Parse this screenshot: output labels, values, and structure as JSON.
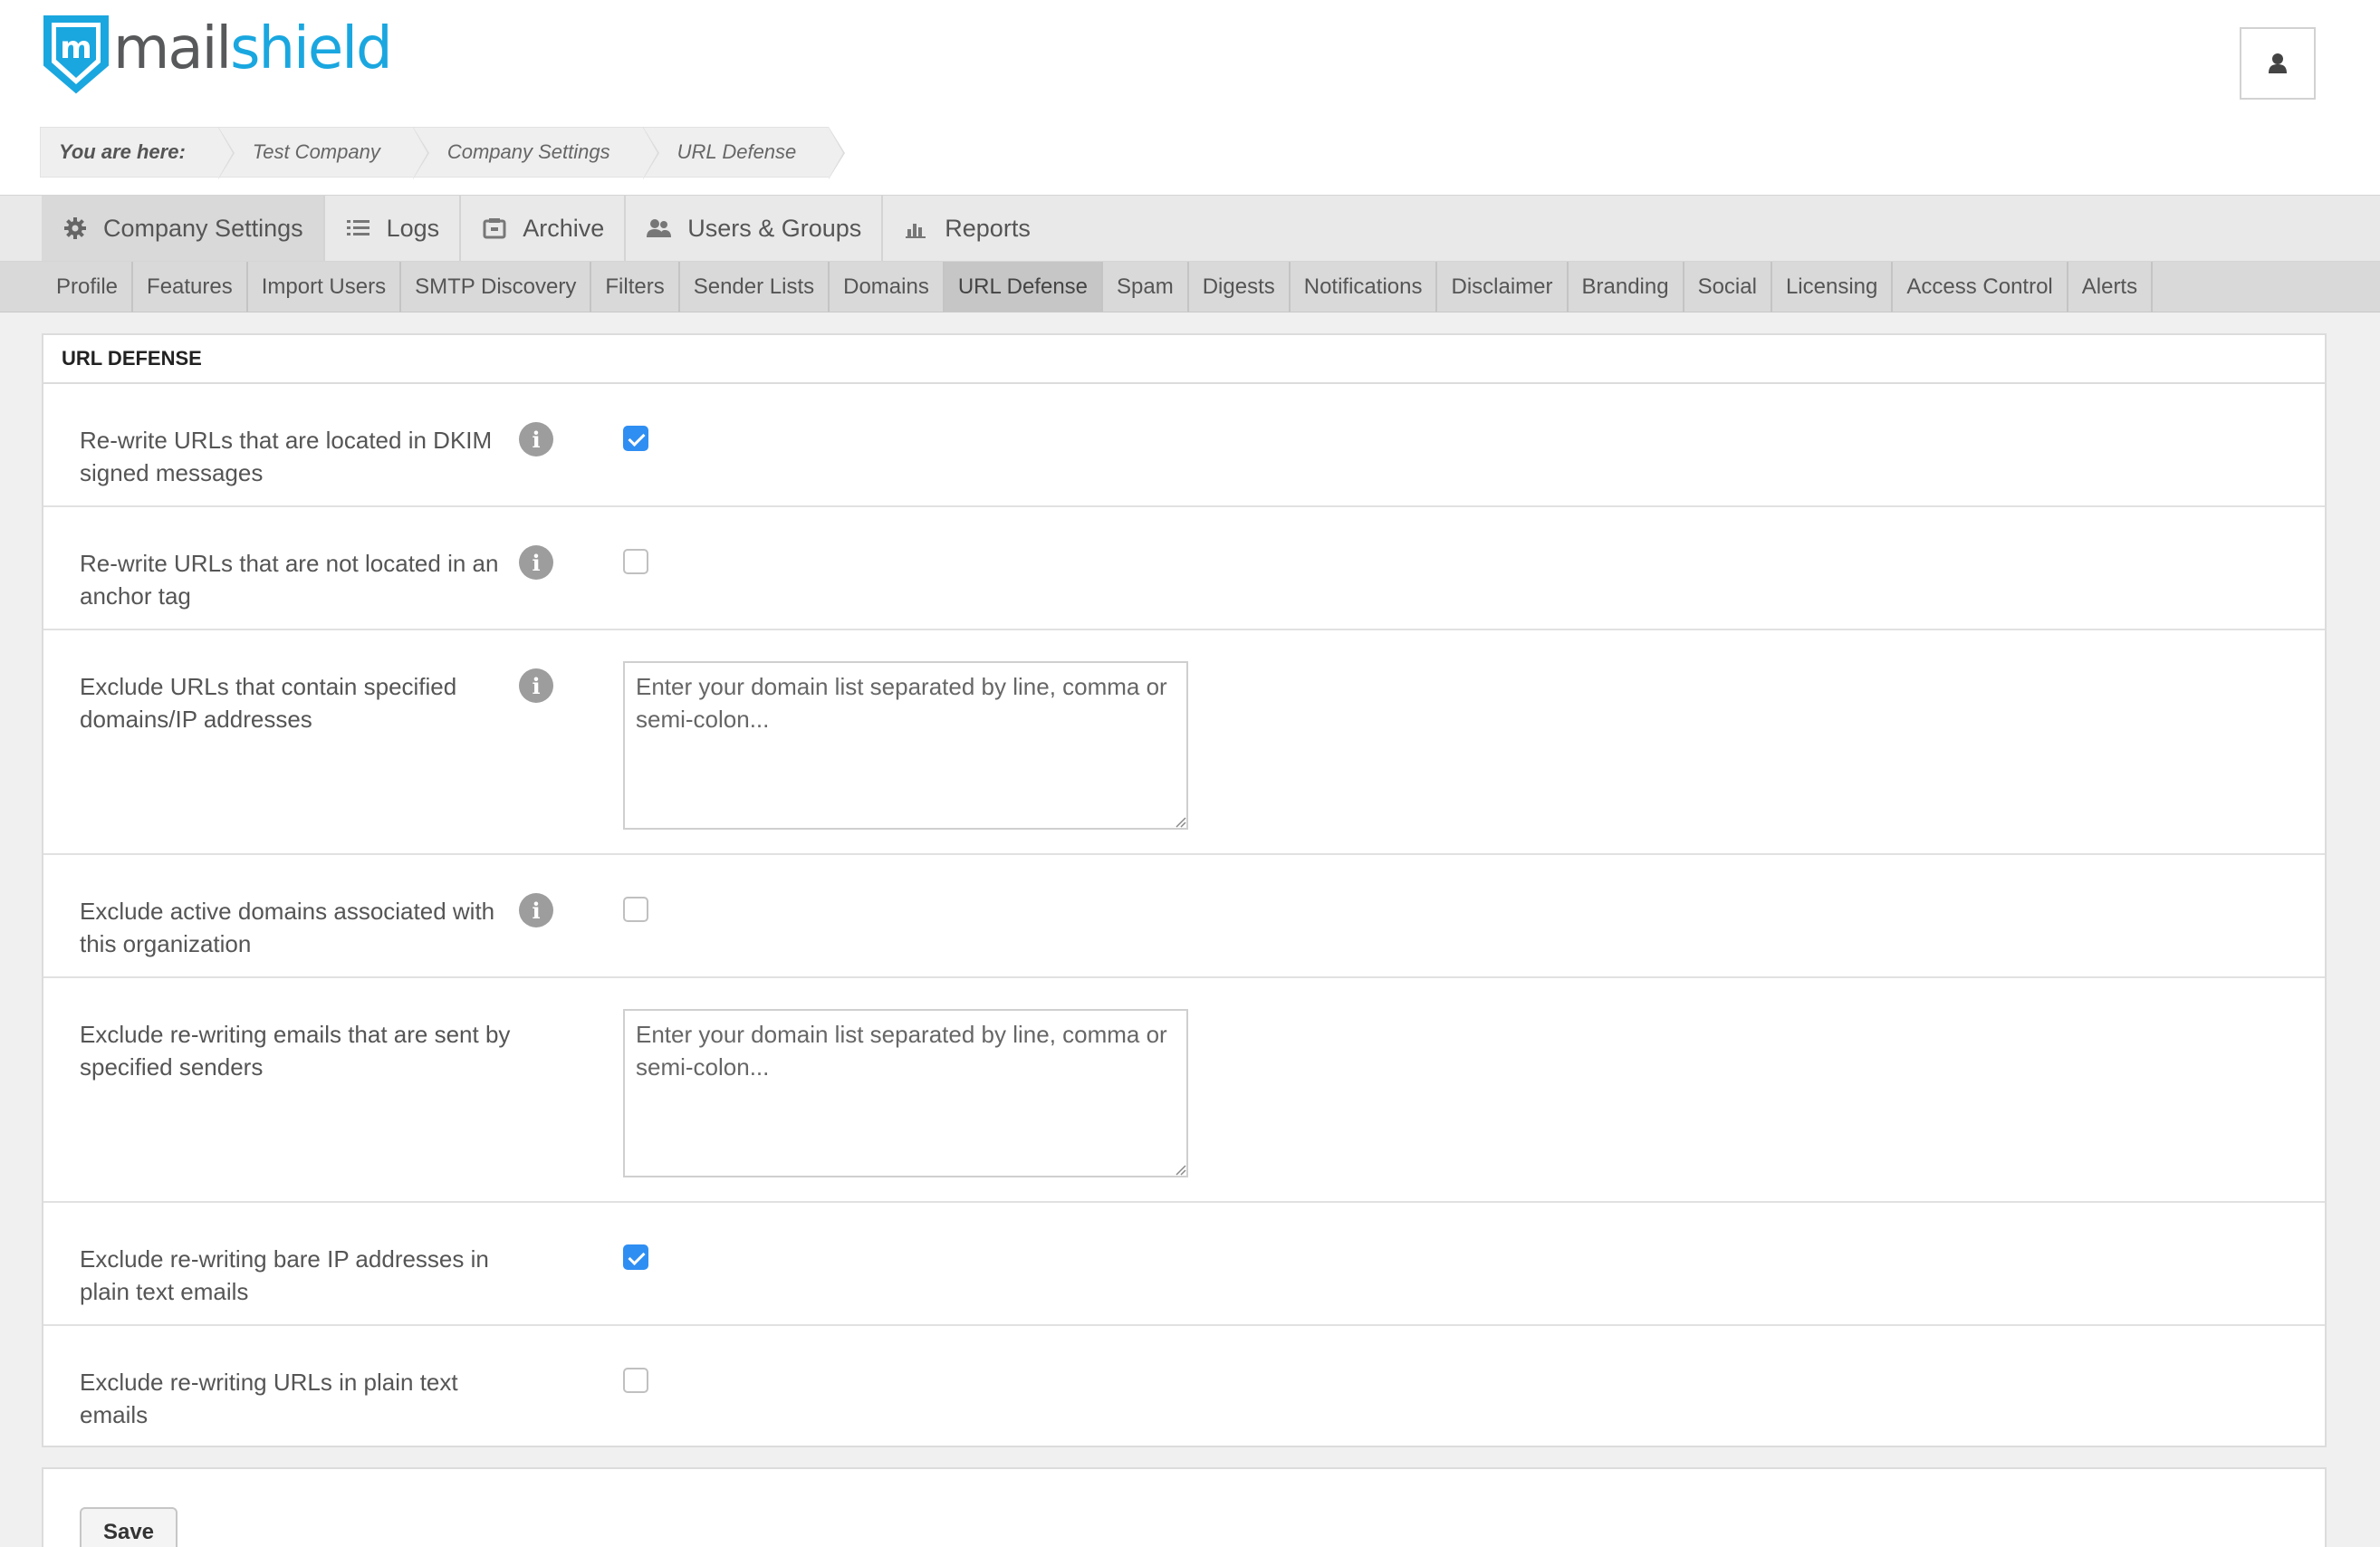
{
  "brand": {
    "mail": "mail",
    "shield": "shield",
    "logo_letter": "m",
    "accent": "#1aa7e0"
  },
  "header": {
    "user_icon": "user-icon"
  },
  "breadcrumb": {
    "prefix": "You are here:",
    "items": [
      "Test Company",
      "Company Settings",
      "URL Defense"
    ]
  },
  "main_nav": {
    "tabs": [
      {
        "label": "Company Settings",
        "icon": "gear-icon",
        "active": true
      },
      {
        "label": "Logs",
        "icon": "list-icon"
      },
      {
        "label": "Archive",
        "icon": "archive-icon"
      },
      {
        "label": "Users & Groups",
        "icon": "users-icon"
      },
      {
        "label": "Reports",
        "icon": "bar-chart-icon"
      }
    ]
  },
  "sub_nav": {
    "tabs": [
      "Profile",
      "Features",
      "Import Users",
      "SMTP Discovery",
      "Filters",
      "Sender Lists",
      "Domains",
      "URL Defense",
      "Spam",
      "Digests",
      "Notifications",
      "Disclaimer",
      "Branding",
      "Social",
      "Licensing",
      "Access Control",
      "Alerts"
    ],
    "active": "URL Defense"
  },
  "panel": {
    "title": "URL DEFENSE",
    "rows": [
      {
        "label": "Re-write URLs that are located in DKIM signed messages",
        "info": true,
        "control": "checkbox",
        "checked": true
      },
      {
        "label": "Re-write URLs that are not located in an anchor tag",
        "info": true,
        "control": "checkbox",
        "checked": false
      },
      {
        "label": "Exclude URLs that contain specified domains/IP addresses",
        "info": true,
        "control": "textarea",
        "placeholder": "Enter your domain list separated by line, comma or semi-colon..."
      },
      {
        "label": "Exclude active domains associated with this organization",
        "info": true,
        "control": "checkbox",
        "checked": false
      },
      {
        "label": "Exclude re-writing emails that are sent by specified senders",
        "info": false,
        "control": "textarea",
        "placeholder": "Enter your domain list separated by line, comma or semi-colon..."
      },
      {
        "label": "Exclude re-writing bare IP addresses in plain text emails",
        "info": false,
        "control": "checkbox",
        "checked": true
      },
      {
        "label": "Exclude re-writing URLs in plain text emails",
        "info": false,
        "control": "checkbox",
        "checked": false
      }
    ]
  },
  "footer": {
    "save_label": "Save"
  },
  "colors": {
    "checkbox_checked": "#2f8ef2",
    "info_icon": "#9d9d9d"
  }
}
